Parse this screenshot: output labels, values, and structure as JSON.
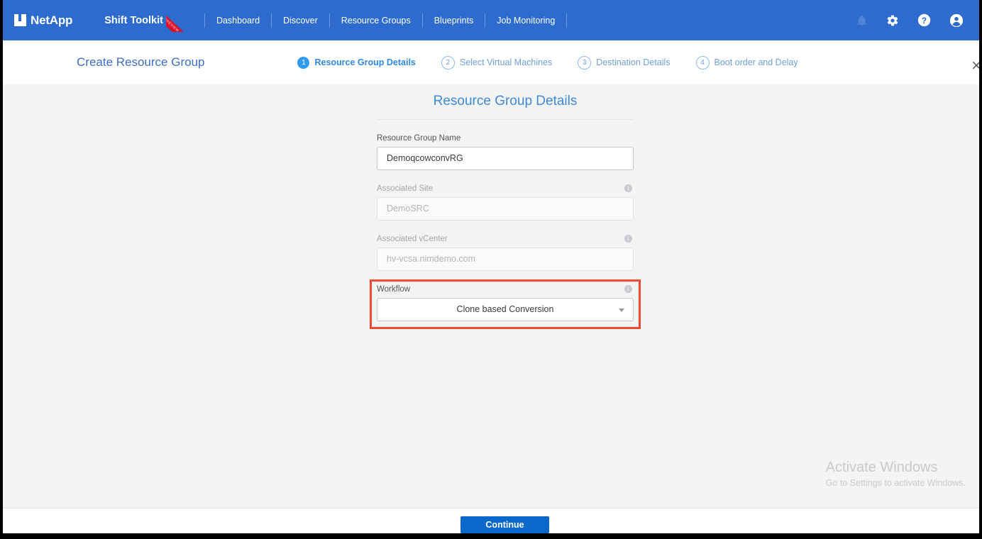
{
  "header": {
    "brand_name": "NetApp",
    "brand_mark_icon": "netapp-logo-icon",
    "product_name": "Shift Toolkit",
    "ribbon_text": "PREVIEW",
    "nav_items": [
      {
        "label": "Dashboard"
      },
      {
        "label": "Discover"
      },
      {
        "label": "Resource Groups"
      },
      {
        "label": "Blueprints"
      },
      {
        "label": "Job Monitoring"
      }
    ],
    "icons": [
      {
        "name": "notification-bell-icon"
      },
      {
        "name": "settings-gear-icon"
      },
      {
        "name": "help-circle-icon"
      },
      {
        "name": "user-account-icon"
      }
    ],
    "background_color": "#2d6cce"
  },
  "wizard": {
    "title": "Create Resource Group",
    "close_label": "×",
    "steps": [
      {
        "number": "1",
        "label": "Resource Group Details",
        "state": "active"
      },
      {
        "number": "2",
        "label": "Select Virtual Machines",
        "state": "idle"
      },
      {
        "number": "3",
        "label": "Destination Details",
        "state": "idle"
      },
      {
        "number": "4",
        "label": "Boot order and Delay",
        "state": "idle"
      }
    ],
    "active_color": "#2e9bf0",
    "idle_color": "#6f9fd8"
  },
  "form": {
    "title": "Resource Group Details",
    "resource_group_name": {
      "label": "Resource Group Name",
      "value": "DemoqcowconvRG"
    },
    "associated_site": {
      "label": "Associated Site",
      "value": "DemoSRC",
      "info_icon": "info-icon"
    },
    "associated_vcenter": {
      "label": "Associated vCenter",
      "value": "hv-vcsa.nimdemo.com",
      "info_icon": "info-icon"
    },
    "workflow": {
      "label": "Workflow",
      "value": "Clone based Conversion",
      "info_icon": "info-icon",
      "highlight_color": "#f04b35"
    }
  },
  "footer": {
    "continue_label": "Continue",
    "button_color": "#0b68cb"
  },
  "watermark": {
    "title": "Activate Windows",
    "subtitle": "Go to Settings to activate Windows."
  }
}
